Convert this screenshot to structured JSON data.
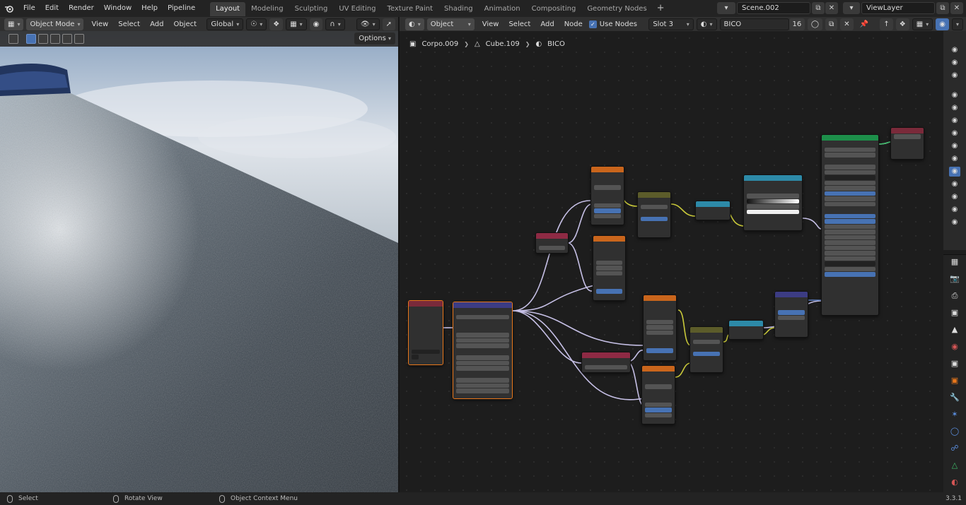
{
  "topbar": {
    "menus": [
      "File",
      "Edit",
      "Render",
      "Window",
      "Help",
      "Pipeline"
    ],
    "workspaces": [
      "Layout",
      "Modeling",
      "Sculpting",
      "UV Editing",
      "Texture Paint",
      "Shading",
      "Animation",
      "Compositing",
      "Geometry Nodes"
    ],
    "active_workspace": "Layout",
    "scene": "Scene.002",
    "view_layer": "ViewLayer"
  },
  "viewport_header": {
    "mode": "Object Mode",
    "menus": [
      "View",
      "Select",
      "Add",
      "Object"
    ],
    "transform": "Global",
    "options": "Options"
  },
  "node_header": {
    "type": "Object",
    "menus": [
      "View",
      "Select",
      "Add",
      "Node"
    ],
    "use_nodes_label": "Use Nodes",
    "slot": "Slot 3",
    "material": "BICO",
    "users": "16"
  },
  "breadcrumb": [
    "Corpo.009",
    "Cube.109",
    "BICO"
  ],
  "status": {
    "select": "Select",
    "rotate": "Rotate View",
    "context": "Object Context Menu",
    "version": "3.3.1"
  },
  "colors": {
    "accent": "#4772b3",
    "selected": "#e8771b",
    "wire": "#c6c0e6",
    "wire_float": "#c9c93a"
  },
  "icons": [
    "blender-logo-icon",
    "camera-icon",
    "render-icon",
    "output-icon",
    "view-layer-icon",
    "scene-icon",
    "world-icon",
    "object-icon",
    "modifier-icon",
    "particles-icon",
    "physics-icon",
    "constraints-icon",
    "data-icon",
    "material-icon"
  ]
}
